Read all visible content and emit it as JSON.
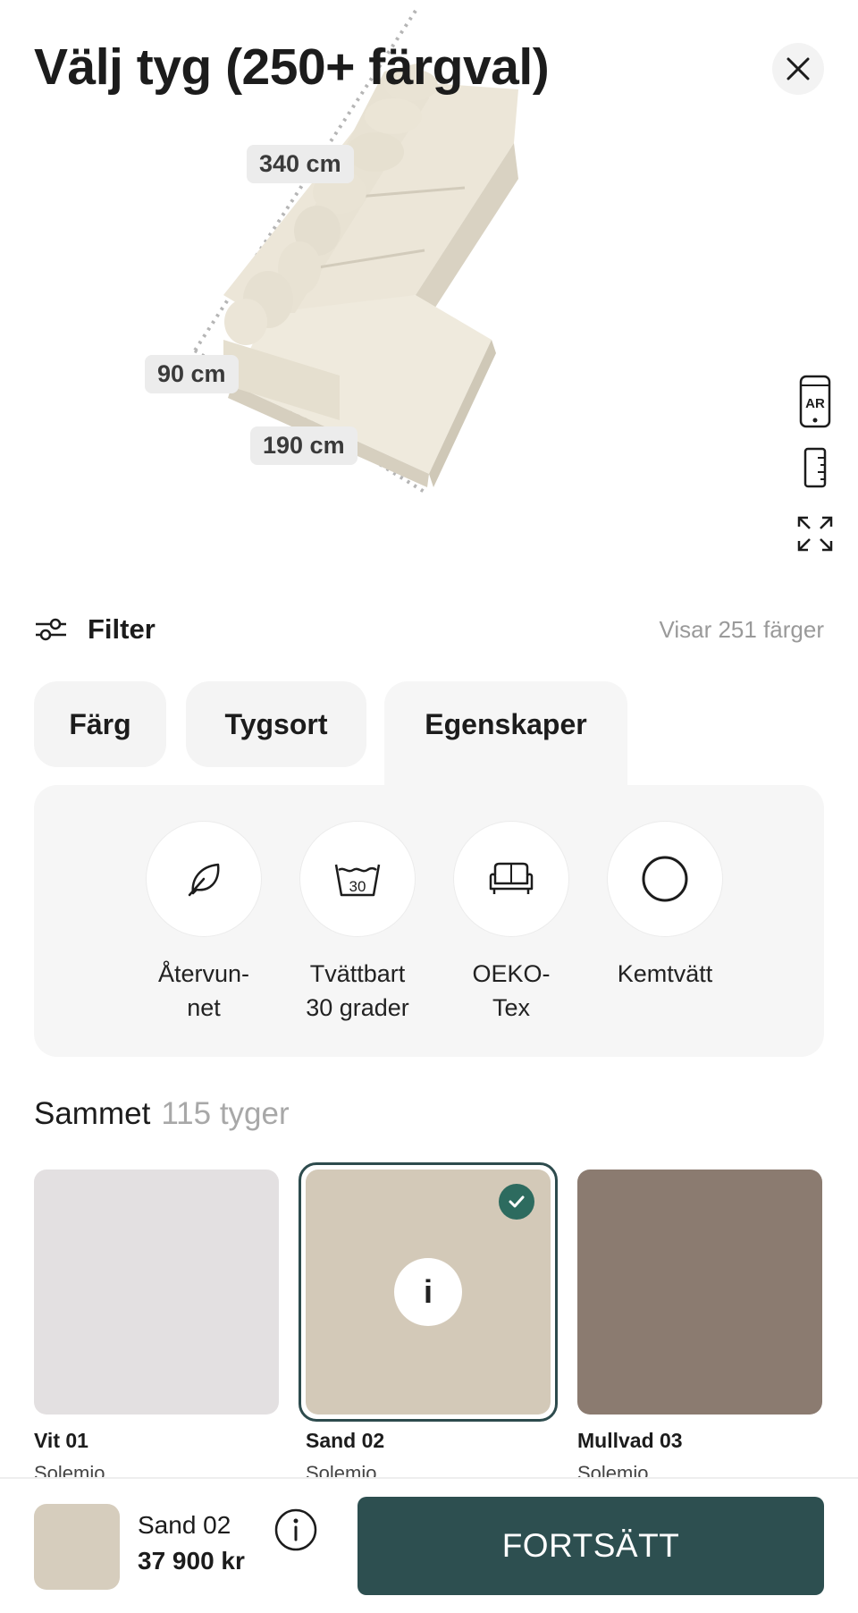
{
  "header": {
    "title": "Välj tyg (250+ färgval)",
    "close_icon": "close-icon"
  },
  "viewer": {
    "dimensions": {
      "length": "340 cm",
      "depth": "90 cm",
      "chaise": "190 cm"
    },
    "tools": [
      {
        "icon": "ar-icon",
        "label": "AR"
      },
      {
        "icon": "measure-icon"
      },
      {
        "icon": "fullscreen-icon"
      }
    ]
  },
  "filter": {
    "label": "Filter",
    "result_count": "Visar 251 färger"
  },
  "tabs": [
    {
      "label": "Färg"
    },
    {
      "label": "Tygsort"
    },
    {
      "label": "Egenskaper",
      "active": true
    }
  ],
  "properties": [
    {
      "label": "Återvun-\nnet",
      "icon": "leaf-icon"
    },
    {
      "label": "Tvättbart\n30 grader",
      "icon": "wash-30-icon",
      "icon_text": "30"
    },
    {
      "label": "OEKO-\nTex",
      "icon": "sofa-icon"
    },
    {
      "label": "Kemtvätt",
      "icon": "circle-icon"
    }
  ],
  "section": {
    "title": "Sammet",
    "count": "115 tyger"
  },
  "swatches": [
    {
      "name": "Vit 01",
      "collection": "Solemio",
      "color": "#e3e0e1",
      "selected": false
    },
    {
      "name": "Sand 02",
      "collection": "Solemio",
      "color": "#d3c9b8",
      "selected": true,
      "info_label": "i"
    },
    {
      "name": "Mullvad 03",
      "collection": "Solemio",
      "color": "#8b7b70",
      "selected": false
    }
  ],
  "bottom_bar": {
    "selected_name": "Sand 02",
    "price": "37 900 kr",
    "continue_label": "FORTSÄTT"
  },
  "colors": {
    "accent": "#2d4f50",
    "check": "#2d6b5f"
  }
}
